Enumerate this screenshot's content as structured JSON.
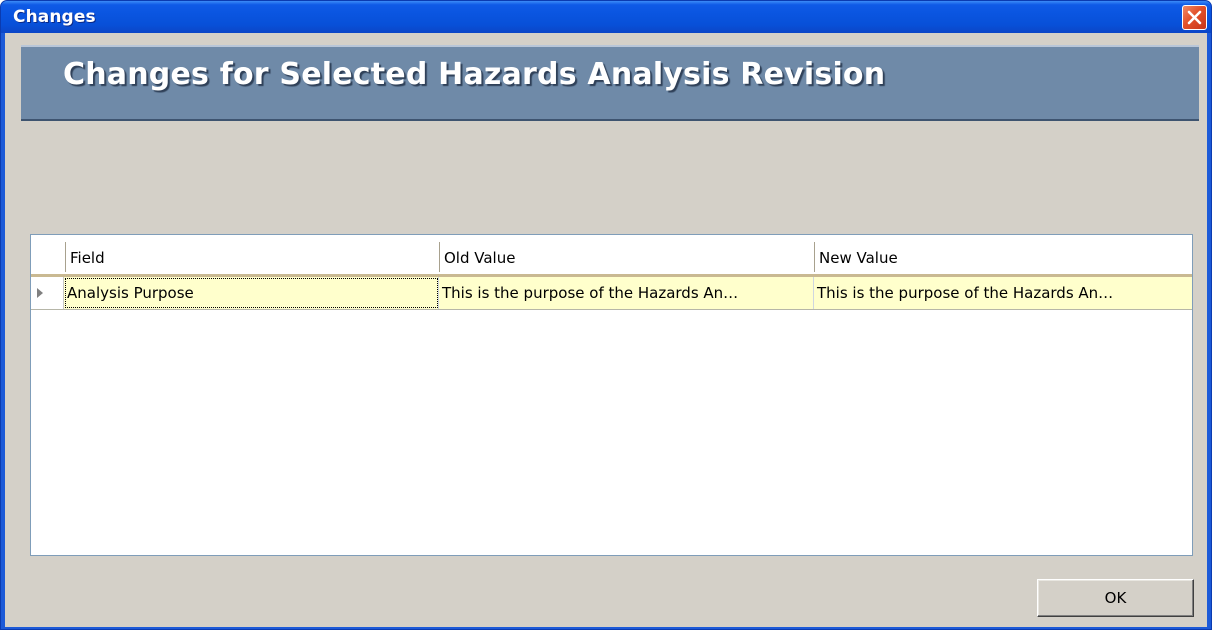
{
  "window": {
    "title": "Changes",
    "close_icon": "close-icon",
    "accent_color": "#0a55e0",
    "close_color": "#e2502a"
  },
  "header": {
    "title": "Changes for Selected Hazards Analysis Revision",
    "band_color": "#6f8aa8"
  },
  "grid": {
    "columns": [
      "Field",
      "Old Value",
      "New Value"
    ],
    "rows": [
      {
        "field": "Analysis Purpose",
        "old_value": "This is the purpose of the Hazards An…",
        "new_value": "This is the purpose of the Hazards An…"
      }
    ],
    "row_indicator_icon": "row-pointer-icon",
    "cell_highlight_color": "#ffffcc"
  },
  "footer": {
    "ok_label": "OK"
  }
}
